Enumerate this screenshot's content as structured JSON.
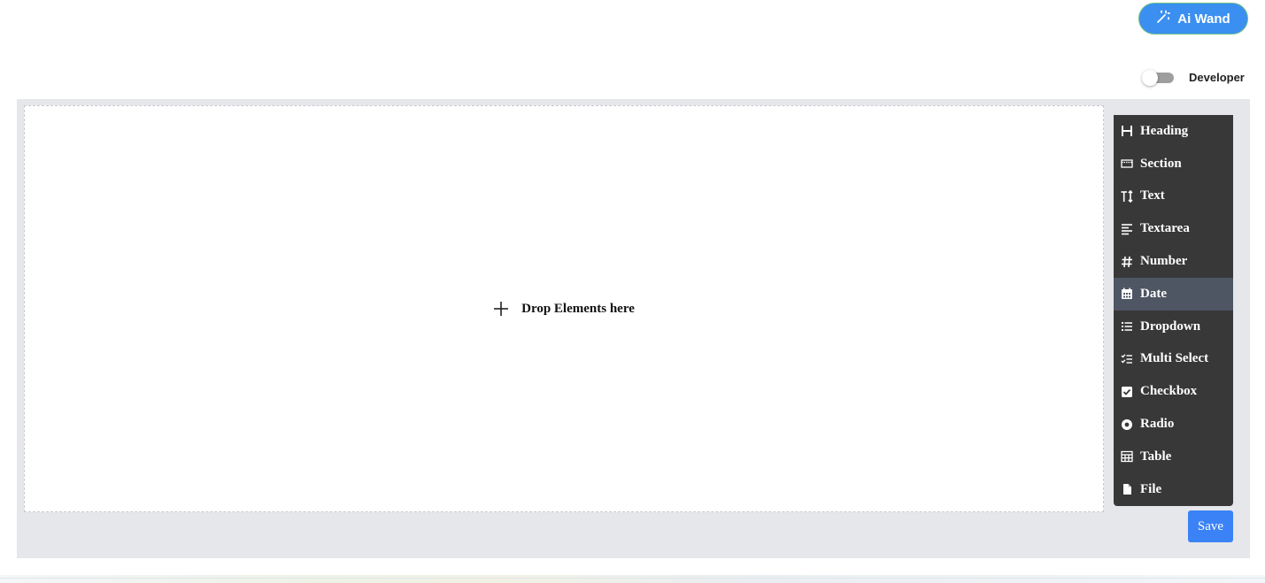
{
  "header": {
    "ai_wand_label": "Ai Wand",
    "developer_label": "Developer",
    "developer_toggle_on": false
  },
  "canvas": {
    "drop_label": "Drop Elements here"
  },
  "palette": {
    "items": [
      {
        "label": "Heading",
        "icon": "heading-icon"
      },
      {
        "label": "Section",
        "icon": "section-icon"
      },
      {
        "label": "Text",
        "icon": "text-size-icon"
      },
      {
        "label": "Textarea",
        "icon": "align-left-icon"
      },
      {
        "label": "Number",
        "icon": "hash-icon"
      },
      {
        "label": "Date",
        "icon": "calendar-icon",
        "active": true
      },
      {
        "label": "Dropdown",
        "icon": "list-icon"
      },
      {
        "label": "Multi Select",
        "icon": "checklist-icon"
      },
      {
        "label": "Checkbox",
        "icon": "checkbox-icon"
      },
      {
        "label": "Radio",
        "icon": "radio-icon"
      },
      {
        "label": "Table",
        "icon": "table-icon"
      },
      {
        "label": "File",
        "icon": "file-icon"
      }
    ]
  },
  "footer": {
    "save_label": "Save"
  },
  "colors": {
    "accent": "#3b82f6",
    "palette_bg": "#383838",
    "palette_active": "#4e5563",
    "workspace_bg": "#e6e7ea"
  }
}
